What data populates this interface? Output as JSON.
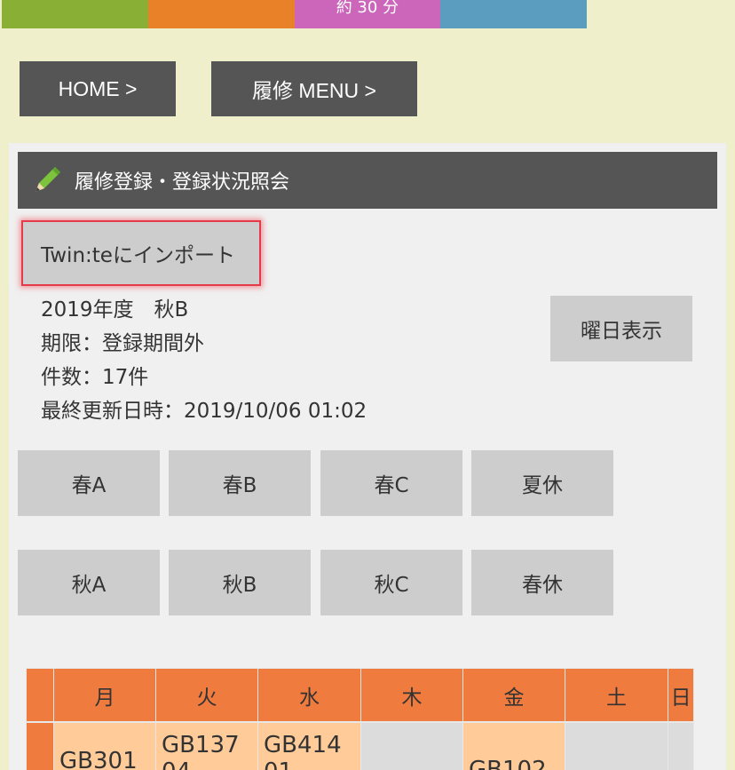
{
  "top_bar": {
    "duration_label": "約 30 分"
  },
  "nav": {
    "home_label": "HOME >",
    "menu_label": "履修 MENU >"
  },
  "panel": {
    "title": "履修登録・登録状況照会",
    "import_button": "Twin:teにインポート",
    "year_term": "2019年度　秋B",
    "deadline": "期限：登録期間外",
    "count": "件数：17件",
    "updated": "最終更新日時：2019/10/06 01:02",
    "weekday_button": "曜日表示",
    "terms_row1": [
      "春A",
      "春B",
      "春C",
      "夏休"
    ],
    "terms_row2": [
      "秋A",
      "秋B",
      "秋C",
      "春休"
    ]
  },
  "timetable": {
    "headers": [
      "",
      "月",
      "火",
      "水",
      "木",
      "金",
      "土",
      "日"
    ],
    "row1": [
      "",
      "GB301",
      "GB137\n04",
      "GB414\n01",
      "",
      "GB102",
      "",
      ""
    ]
  },
  "colors": {
    "bg": "#efefcc",
    "nav": "#555555",
    "accent_orange": "#f07b3e",
    "cell_active": "#ffcc99",
    "cell_empty": "#dcdcdc",
    "highlight_border": "#e53a4a"
  },
  "icons": {
    "pencil": "pencil-icon"
  }
}
